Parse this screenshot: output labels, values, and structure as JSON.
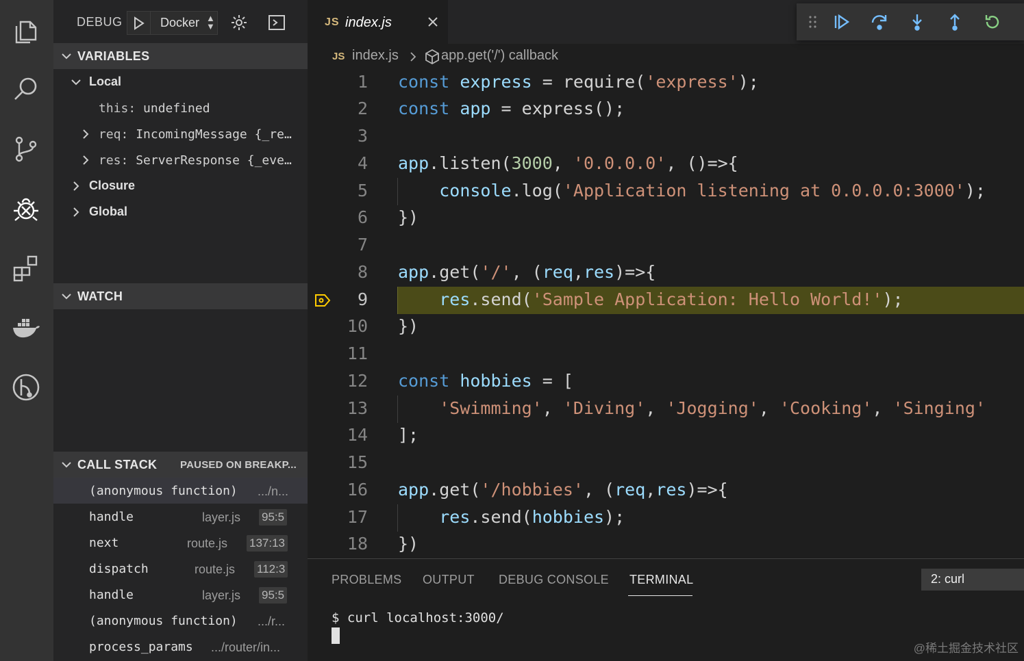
{
  "debug_toolbar": {
    "label": "DEBUG",
    "configuration": "Docker"
  },
  "variables": {
    "title": "VARIABLES",
    "scopes": [
      {
        "label": "Local"
      },
      {
        "label": "Closure"
      },
      {
        "label": "Global"
      }
    ],
    "local_items": [
      {
        "name": "this:",
        "value": "undefined"
      },
      {
        "name": "req:",
        "value": "IncomingMessage {_re…"
      },
      {
        "name": "res:",
        "value": "ServerResponse {_eve…"
      }
    ]
  },
  "watch": {
    "title": "WATCH"
  },
  "call_stack": {
    "title": "CALL STACK",
    "status": "PAUSED ON BREAKP...",
    "frames": [
      {
        "fn": "(anonymous function)",
        "file": ".../n...",
        "line": ""
      },
      {
        "fn": "handle",
        "file": "layer.js",
        "line": "95:5"
      },
      {
        "fn": "next",
        "file": "route.js",
        "line": "137:13"
      },
      {
        "fn": "dispatch",
        "file": "route.js",
        "line": "112:3"
      },
      {
        "fn": "handle",
        "file": "layer.js",
        "line": "95:5"
      },
      {
        "fn": "(anonymous function)",
        "file": ".../r...",
        "line": ""
      },
      {
        "fn": "process_params",
        "file": ".../router/in...",
        "line": ""
      }
    ]
  },
  "editor": {
    "tab": {
      "lang": "JS",
      "name": "index.js"
    },
    "breadcrumb": {
      "lang": "JS",
      "file": "index.js",
      "symbol": "app.get('/') callback"
    },
    "current_line": 9,
    "line_numbers": [
      "1",
      "2",
      "3",
      "4",
      "5",
      "6",
      "7",
      "8",
      "9",
      "10",
      "11",
      "12",
      "13",
      "14",
      "15",
      "16",
      "17",
      "18"
    ]
  },
  "panel": {
    "tabs": [
      "PROBLEMS",
      "OUTPUT",
      "DEBUG CONSOLE",
      "TERMINAL"
    ],
    "active_tab": "TERMINAL",
    "terminal_select": "2: curl",
    "terminal_line": "$ curl localhost:3000/"
  },
  "watermark": "@稀土掘金技术社区",
  "colors": {
    "activity_bar": "#333333",
    "sidebar": "#252526",
    "editor_bg": "#1e1e1e",
    "breakpoint_highlight": "#4b4b18",
    "keyword": "#569cd6",
    "string": "#ce9178",
    "variable": "#9cdcfe",
    "number": "#b5cea8"
  },
  "icons": [
    "explorer-icon",
    "search-icon",
    "source-control-icon",
    "debug-icon",
    "extensions-icon",
    "docker-icon",
    "gitlens-icon",
    "play-icon",
    "gear-icon",
    "terminal-icon",
    "continue-icon",
    "step-over-icon",
    "step-into-icon",
    "step-out-icon",
    "restart-icon"
  ]
}
